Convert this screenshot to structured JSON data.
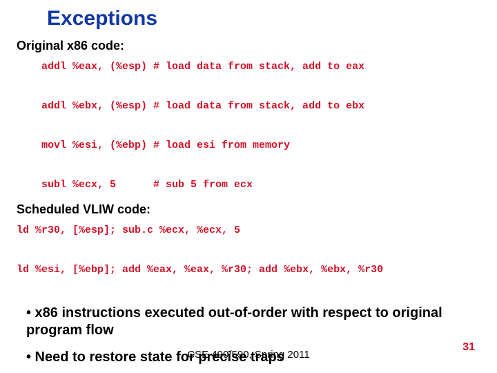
{
  "title": "Exceptions",
  "sub1": "Original x86 code:",
  "code1": "addl %eax, (%esp) # load data from stack, add to eax\n\naddl %ebx, (%esp) # load data from stack, add to ebx\n\nmovl %esi, (%ebp) # load esi from memory\n\nsubl %ecx, 5      # sub 5 from ecx",
  "sub2": "Scheduled VLIW code:",
  "code2": "ld %r30, [%esp]; sub.c %ecx, %ecx, 5\n\nld %esi, [%ebp]; add %eax, %eax, %r30; add %ebx, %ebx, %r30",
  "b1": "• x86 instructions executed out-of-order with respect to original program flow",
  "b2": "• Need to restore state for precise traps",
  "footer": "CSE 490/590, Spring 2011",
  "pagenum": "31"
}
